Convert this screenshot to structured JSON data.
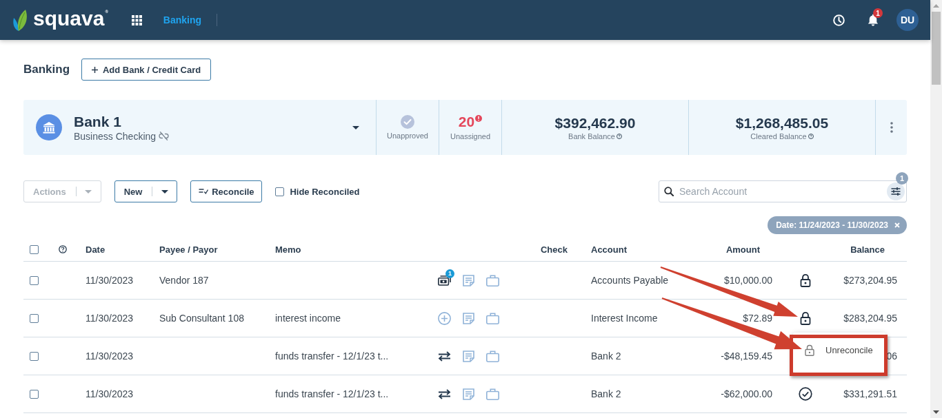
{
  "header": {
    "logo": "squava$^{®}$",
    "nav_link": "Banking",
    "notifications_badge": "1",
    "avatar": "DU"
  },
  "page": {
    "title": "Banking",
    "add_button": "Add Bank / Credit Card"
  },
  "account": {
    "name": "Bank 1",
    "type": "Business Checking",
    "stats": [
      {
        "kind": "status",
        "label": "Unapproved"
      },
      {
        "kind": "count",
        "value": "20",
        "alert": true,
        "label": "Unassigned"
      }
    ],
    "balances": [
      {
        "amount": "$392,462.90",
        "label": "Bank Balance"
      },
      {
        "amount": "$1,268,485.05",
        "label": "Cleared Balance"
      }
    ]
  },
  "toolbar": {
    "split_buttons": [
      {
        "label": "Actions",
        "disabled": true
      },
      {
        "label": "New",
        "disabled": false
      }
    ],
    "reconcile_button": "Reconcile",
    "hide_reconciled": {
      "label": "Hide Reconciled",
      "checked": false
    },
    "search": {
      "placeholder": "Search Account"
    },
    "filter_badge": "1"
  },
  "filter_chips": [
    {
      "label": "Date: 11/24/2023 - 11/30/2023"
    }
  ],
  "table": {
    "select_all": {
      "checked": false
    },
    "columns": [
      "Date",
      "Payee / Payor",
      "Memo",
      "Check",
      "Account",
      "Amount",
      "Balance"
    ],
    "rows": [
      {
        "checked": false,
        "date": "11/30/2023",
        "payee": "Vendor 187",
        "match_icon": {
          "kind": "cash",
          "badge": "1"
        },
        "account": "Accounts Payable",
        "amount": "$10,000.00",
        "status_icon": {
          "kind": "locked"
        },
        "balance": "$273,204.95"
      },
      {
        "checked": false,
        "date": "11/30/2023",
        "payee": "Sub Consultant 108",
        "memo": "interest income",
        "match_icon": {
          "kind": "add"
        },
        "account": "Interest Income",
        "amount": "$72.89",
        "status_icon": {
          "kind": "locked"
        },
        "balance": "$283,204.95"
      },
      {
        "checked": false,
        "date": "11/30/2023",
        "memo": "funds transfer - 12/1/23 t...",
        "match_icon": {
          "kind": "transfer"
        },
        "account": "Bank 2",
        "amount": "-$48,159.45",
        "balance": "06"
      },
      {
        "checked": false,
        "date": "11/30/2023",
        "memo": "funds transfer - 12/1/23 t...",
        "match_icon": {
          "kind": "transfer"
        },
        "account": "Bank 2",
        "amount": "-$62,000.00",
        "status_icon": {
          "kind": "reconciled"
        },
        "balance": "$331,291.51"
      }
    ]
  },
  "context_menu": {
    "items": [
      {
        "label": "Unreconcile"
      }
    ]
  }
}
